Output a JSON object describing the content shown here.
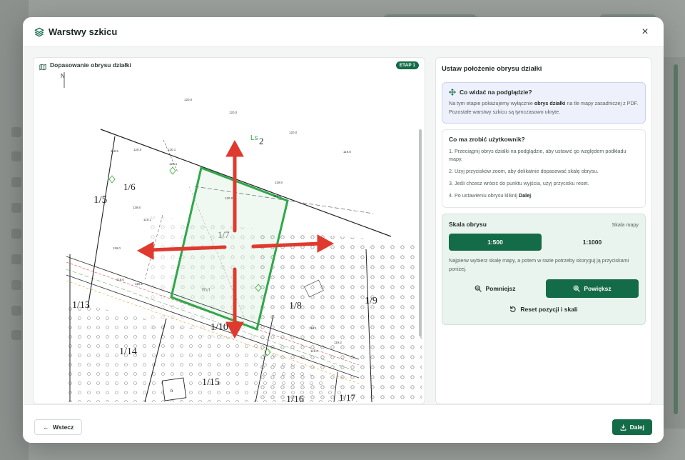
{
  "modal": {
    "title": "Warstwy szkicu",
    "close_label": "×"
  },
  "left_panel": {
    "title": "Dopasowanie obrysu działki",
    "badge": "ETAP 1",
    "map_labels": {
      "n": "N",
      "parcel_1_5": "1/5",
      "parcel_1_6": "1/6",
      "parcel_1_7": "1/7",
      "parcel_1_8": "1/8",
      "parcel_1_9": "1/9",
      "parcel_1_10": "1/10",
      "parcel_1_13": "1/13",
      "parcel_1_14": "1/14",
      "parcel_1_15": "1/15",
      "parcel_1_16": "1/16",
      "parcel_1_17": "1/17",
      "ls": "Ls",
      "two": "2",
      "rvi": "RVI",
      "box_letter": "b"
    }
  },
  "right_panel": {
    "title": "Ustaw położenie obrysu działki",
    "info": {
      "heading": "Co widać na podglądzie?",
      "text_before": "Na tym etapie pokazujemy wyłącznie ",
      "text_bold": "obrys działki",
      "text_after": " na tle mapy zasadniczej z PDF. Pozostałe warstwy szkicu są tymczasowo ukryte."
    },
    "user": {
      "heading": "Co ma zrobić użytkownik?",
      "step1": "1. Przeciągnij obrys działki na podglądzie, aby ustawić go względem podkładu mapy.",
      "step2": "2. Użyj przycisków zoom, aby delikatnie dopasować skalę obrysu.",
      "step3": "3. Jeśli chcesz wrócić do punktu wyjścia, użyj przycisku reset.",
      "step4_before": "4. Po ustawieniu obrysu kliknij ",
      "step4_bold": "Dalej",
      "step4_after": "."
    },
    "scale": {
      "heading": "Skala obrysu",
      "map_scale_label": "Skala mapy",
      "option_a": "1:500",
      "option_b": "1:1000",
      "selected": "1:500",
      "description": "Najpierw wybierz skalę mapy, a potem w razie potrzeby skoryguj ją przyciskami poniżej.",
      "zoom_out": "Pomniejsz",
      "zoom_in": "Powiększ",
      "reset": "Reset pozycji i skali"
    }
  },
  "footer": {
    "back": "Wstecz",
    "next": "Dalej"
  },
  "colors": {
    "brand": "#146b47",
    "outline": "#2fa84a",
    "arrow": "#e03a2f"
  }
}
